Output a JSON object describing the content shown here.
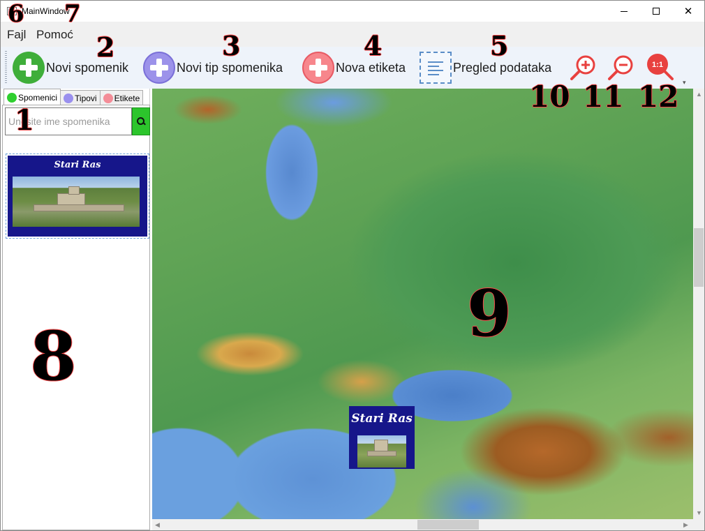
{
  "window": {
    "title": "MainWindow",
    "close_glyph": "✕"
  },
  "menu": {
    "items": [
      "Fajl",
      "Pomoć"
    ]
  },
  "toolbar": {
    "buttons": [
      {
        "label": "Novi spomenik",
        "icon": "add-green-icon",
        "color": "#3fae3a"
      },
      {
        "label": "Novi tip spomenika",
        "icon": "add-purple-icon",
        "color": "#9c92ea"
      },
      {
        "label": "Nova etiketa",
        "icon": "add-pink-icon",
        "color": "#f7868c"
      },
      {
        "label": "Pregled podataka",
        "icon": "document-icon",
        "color": "#5a8dc7"
      }
    ],
    "zoom": {
      "zoom_in_icon": "zoom-in-icon",
      "zoom_out_icon": "zoom-out-icon",
      "actual_size_icon": "actual-size-icon",
      "actual_size_text": "1:1",
      "accent": "#e8413f"
    }
  },
  "left_panel": {
    "tabs": [
      {
        "label": "Spomenici",
        "dot_color": "#2fcf2f"
      },
      {
        "label": "Tipovi",
        "dot_color": "#9a90ee"
      },
      {
        "label": "Etikete",
        "dot_color": "#f48d98"
      }
    ],
    "search": {
      "placeholder": "Unesite ime spomenika",
      "value": ""
    },
    "list": [
      {
        "title": "Stari Ras"
      }
    ]
  },
  "map": {
    "markers": [
      {
        "title": "Stari Ras"
      }
    ]
  },
  "annotations": [
    "1",
    "2",
    "3",
    "4",
    "5",
    "6",
    "7",
    "8",
    "9",
    "10",
    "11",
    "12"
  ]
}
